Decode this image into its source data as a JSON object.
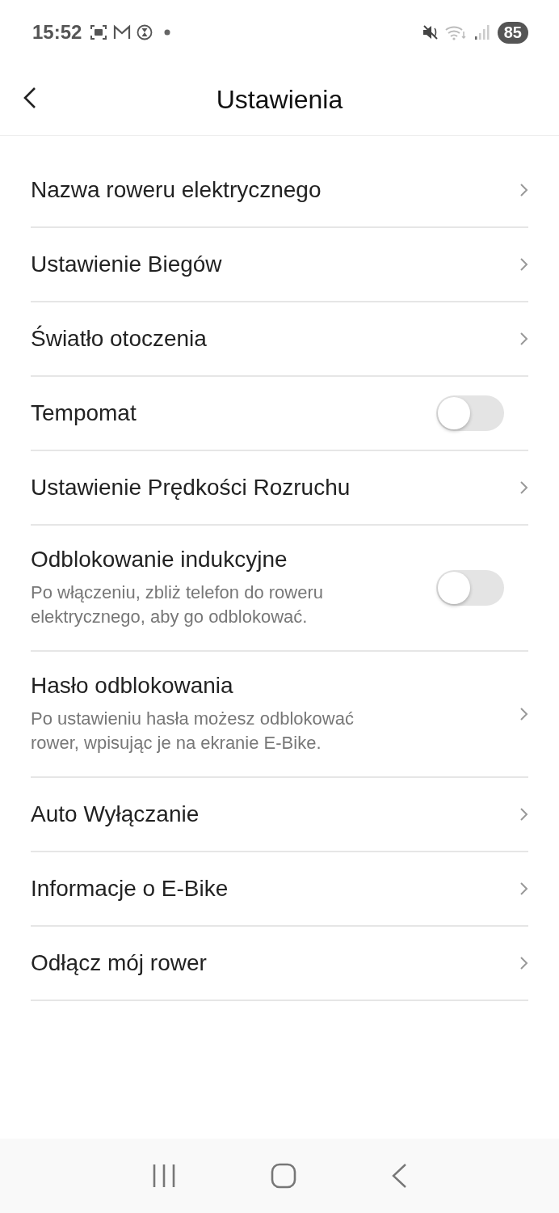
{
  "status_bar": {
    "time": "15:52",
    "battery": "85"
  },
  "header": {
    "title": "Ustawienia"
  },
  "items": [
    {
      "kind": "link",
      "label": "Nazwa roweru elektrycznego"
    },
    {
      "kind": "link",
      "label": "Ustawienie Biegów"
    },
    {
      "kind": "link",
      "label": "Światło otoczenia"
    },
    {
      "kind": "toggle",
      "label": "Tempomat",
      "on": false
    },
    {
      "kind": "link",
      "label": "Ustawienie Prędkości Rozruchu"
    },
    {
      "kind": "toggle",
      "label": "Odblokowanie indukcyjne",
      "description": "Po włączeniu, zbliż telefon do roweru elektrycznego, aby go odblokować.",
      "on": false
    },
    {
      "kind": "link",
      "label": "Hasło odblokowania",
      "description": "Po ustawieniu hasła możesz odblokować rower, wpisując je na ekranie E-Bike."
    },
    {
      "kind": "link",
      "label": "Auto Wyłączanie"
    },
    {
      "kind": "link",
      "label": "Informacje o E-Bike"
    },
    {
      "kind": "link",
      "label": "Odłącz mój rower"
    }
  ]
}
